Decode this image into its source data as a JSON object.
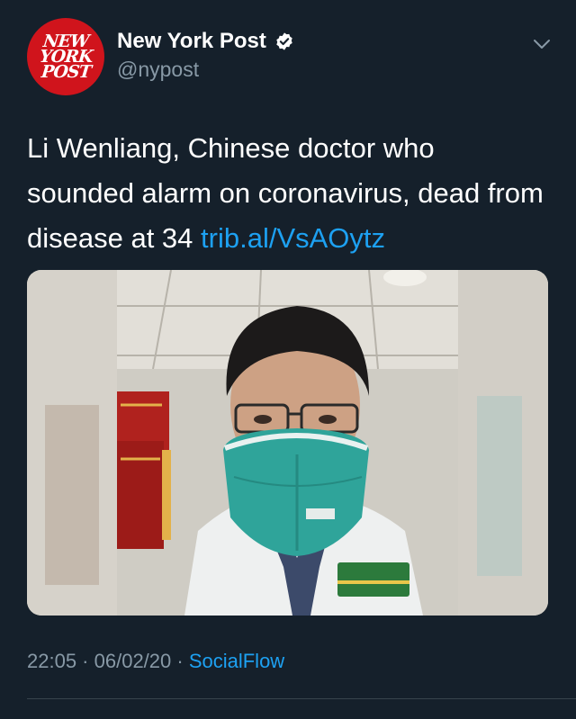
{
  "author": {
    "avatar_lines": [
      "NEW",
      "YORK",
      "POST"
    ],
    "display_name": "New York Post",
    "handle": "@nypost",
    "verified_icon": "verified-badge-icon",
    "menu_icon": "chevron-down-icon"
  },
  "tweet": {
    "text": "Li Wenliang, Chinese doctor who sounded alarm on coronavirus, dead from disease at 34 ",
    "link": "trib.al/VsAOytz"
  },
  "media": {
    "description_icon": "photo-man-wearing-mask"
  },
  "meta": {
    "time": "22:05",
    "separator1": " · ",
    "date": "06/02/20",
    "separator2": " · ",
    "source": "SocialFlow"
  },
  "colors": {
    "background": "#15202b",
    "link": "#1da1f2",
    "muted": "#8899a6",
    "brand_red": "#d0141c"
  }
}
